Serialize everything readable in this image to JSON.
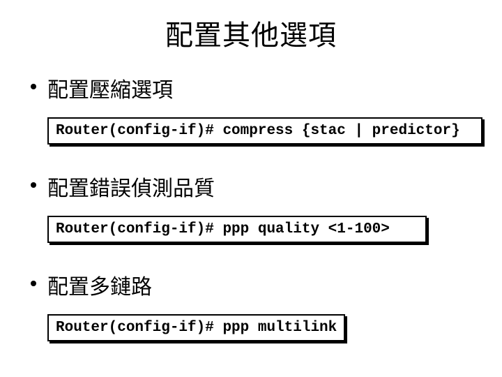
{
  "title": "配置其他選項",
  "items": [
    {
      "bullet": "配置壓縮選項",
      "code": "Router(config-if)# compress {stac | predictor}"
    },
    {
      "bullet": "配置錯誤偵測品質",
      "code": "Router(config-if)# ppp quality <1-100>"
    },
    {
      "bullet": "配置多鏈路",
      "code": "Router(config-if)# ppp multilink"
    }
  ]
}
